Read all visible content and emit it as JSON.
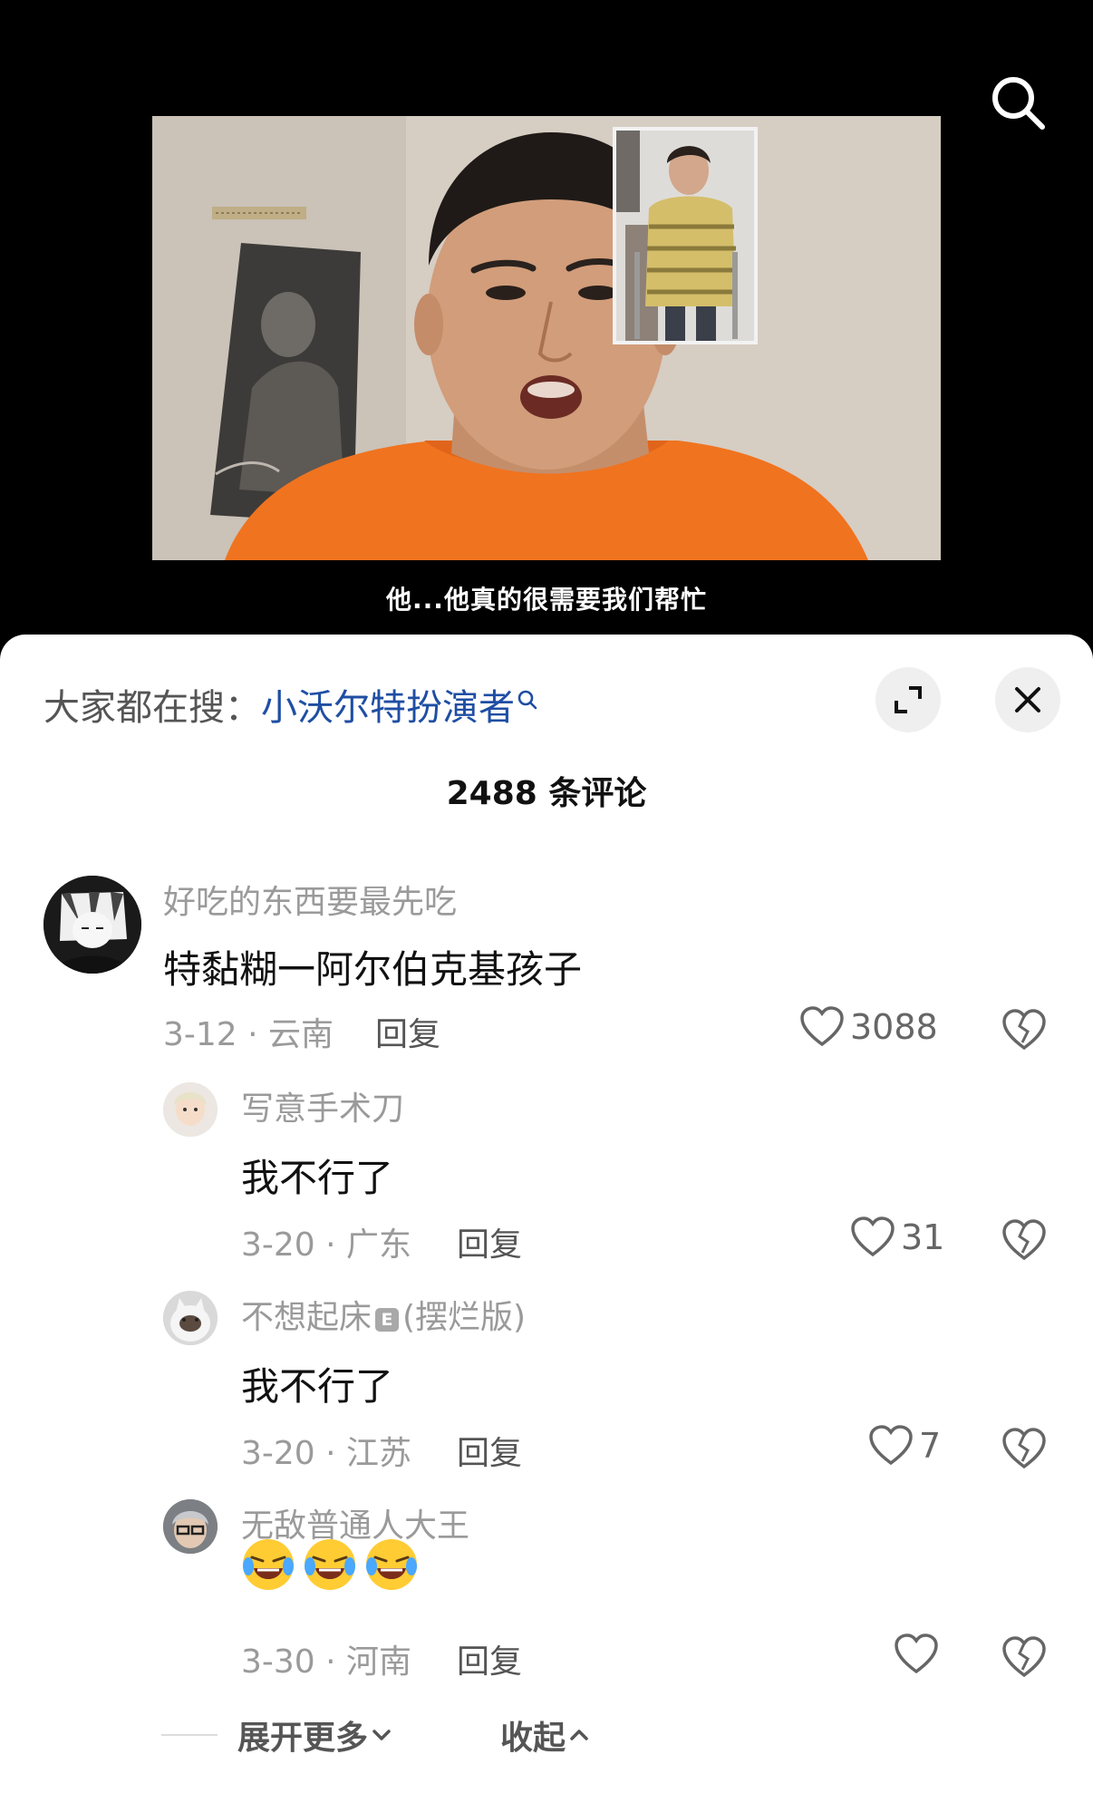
{
  "video": {
    "subtitle": "他...他真的很需要我们帮忙"
  },
  "sheet": {
    "hot_search_prefix": "大家都在搜：",
    "hot_search_keyword": "小沃尔特扮演者",
    "comment_count_label": "2488 条评论"
  },
  "comments": [
    {
      "name": "好吃的东西要最先吃",
      "text": "特黏糊一阿尔伯克基孩子",
      "meta": "3-12 · 云南",
      "reply_label": "回复",
      "likes": "3088"
    }
  ],
  "replies": [
    {
      "name": "写意手术刀",
      "text": "我不行了",
      "meta": "3-20 · 广东",
      "reply_label": "回复",
      "likes": "31"
    },
    {
      "name": "不想起床",
      "badge": "E",
      "name_suffix": "(摆烂版)",
      "text": "我不行了",
      "meta": "3-20 · 江苏",
      "reply_label": "回复",
      "likes": "7"
    },
    {
      "name": "无敌普通人大王",
      "emoji": [
        "crying-laughing-emoji",
        "crying-laughing-emoji",
        "crying-laughing-emoji"
      ],
      "meta": "3-30 · 河南",
      "reply_label": "回复",
      "likes": ""
    }
  ],
  "footer": {
    "expand_label": "展开更多",
    "collapse_label": "收起"
  },
  "colors": {
    "keyword": "#1f4ea3",
    "meta_gray": "#9a9a9a",
    "sheet_bg": "#ffffff",
    "video_bg": "#000000",
    "shirt_orange": "#f0731f"
  }
}
